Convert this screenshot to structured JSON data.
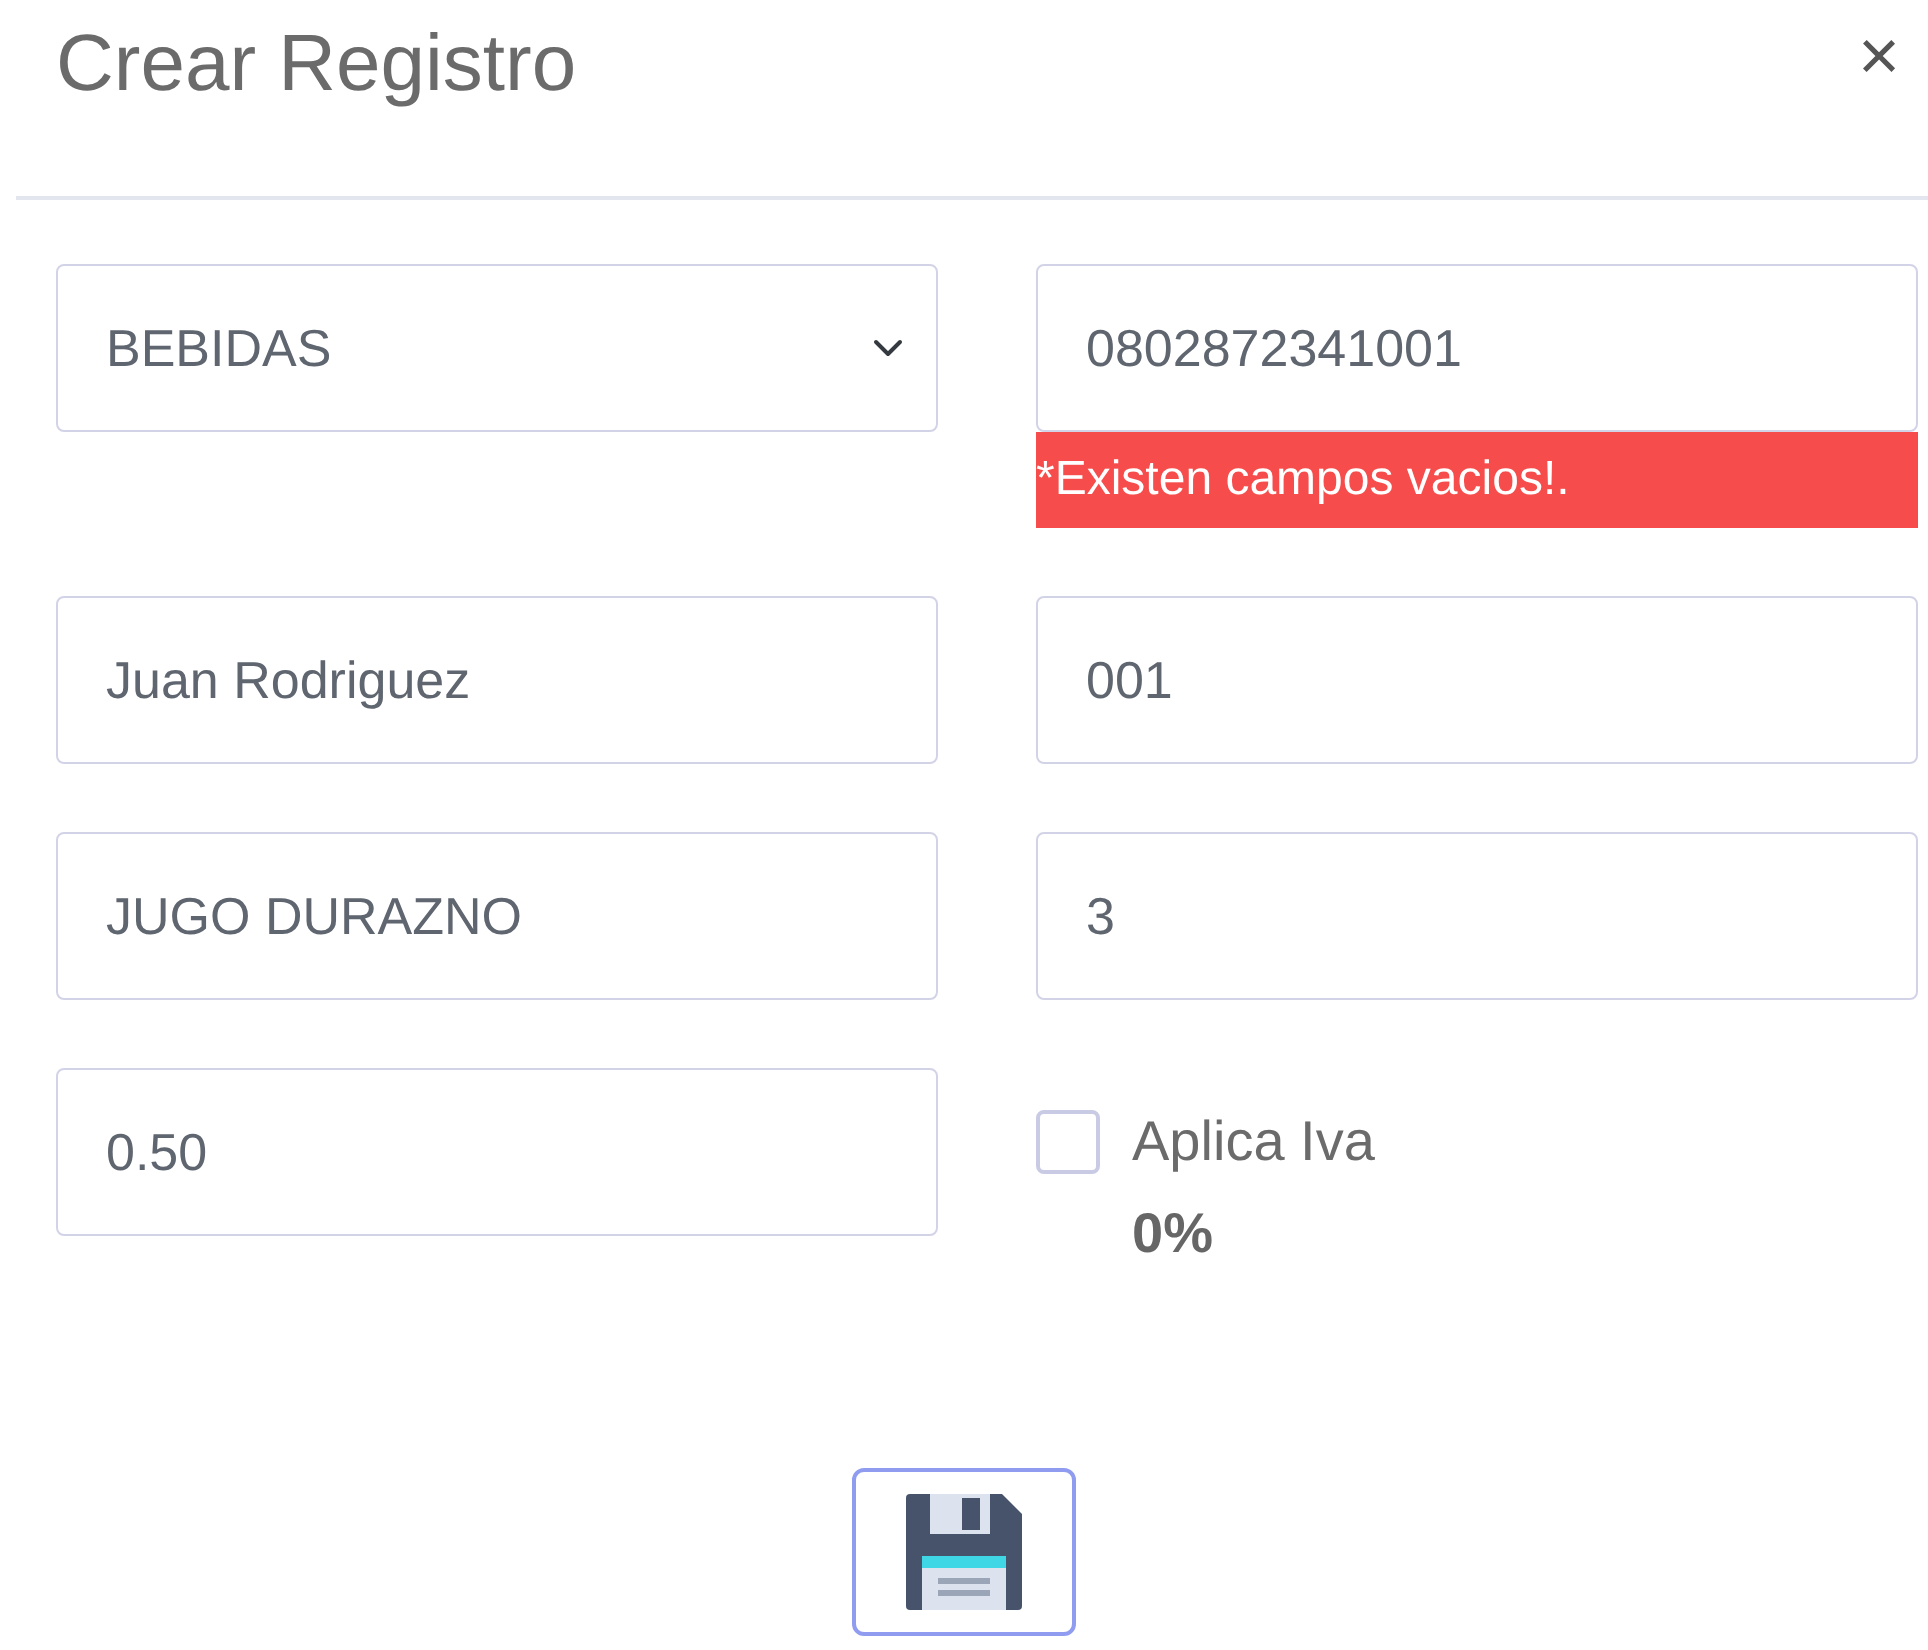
{
  "modal": {
    "title": "Crear Registro",
    "close": "×"
  },
  "fields": [
    {
      "kind": "select",
      "value": "BEBIDAS"
    },
    {
      "kind": "input",
      "value": "0802872341001",
      "error": "*Existen campos vacios!."
    },
    {
      "kind": "input",
      "value": "Juan Rodriguez"
    },
    {
      "kind": "input",
      "value": "001"
    },
    {
      "kind": "input",
      "value": "JUGO DURAZNO"
    },
    {
      "kind": "input",
      "value": "3"
    },
    {
      "kind": "input",
      "value": "0.50"
    },
    {
      "kind": "checkbox",
      "label": "Aplica Iva",
      "checked": false,
      "note": "0%"
    }
  ],
  "save_button": {
    "kind": "icon"
  }
}
